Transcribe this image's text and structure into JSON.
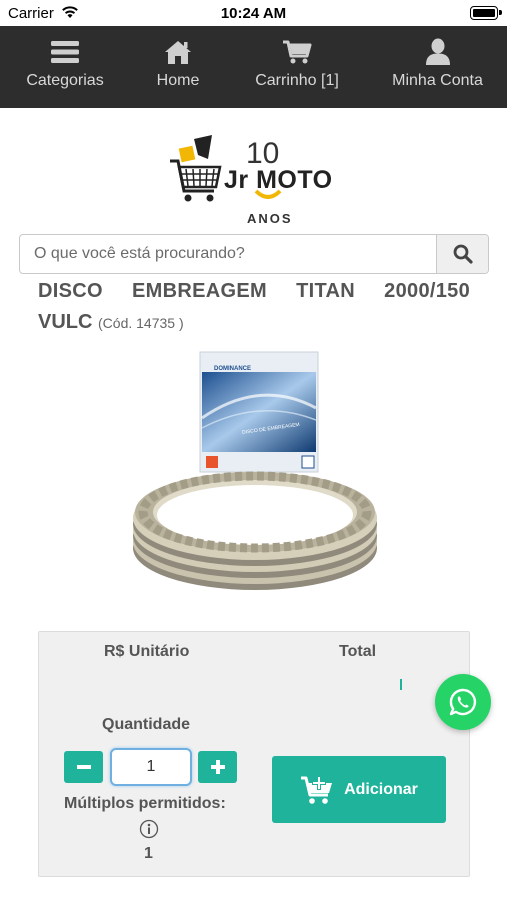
{
  "status_bar": {
    "carrier": "Carrier",
    "time": "10:24 AM"
  },
  "nav": {
    "items": [
      {
        "label": "Categorias",
        "icon": "menu-icon"
      },
      {
        "label": "Home",
        "icon": "home-icon"
      },
      {
        "label": "Carrinho [1]",
        "icon": "cart-icon"
      },
      {
        "label": "Minha Conta",
        "icon": "user-icon"
      }
    ]
  },
  "logo": {
    "number": "10",
    "brand": "Jr MOTO",
    "subtitle": "ANOS"
  },
  "search": {
    "placeholder": "O que você está procurando?",
    "value": ""
  },
  "product": {
    "title_line1": "DISCO EMBREAGEM TITAN 2000/150",
    "title_line2": "VULC",
    "code": "(Cód. 14735 )",
    "box_brand": "DOMINANCE",
    "box_text": "DISCO DE EMBREAGEM"
  },
  "pricing": {
    "unit_label": "R$ Unitário",
    "total_label": "Total",
    "quantity_label": "Quantidade",
    "quantity_value": "1",
    "multiples_label": "Múltiplos permitidos:",
    "multiples_value": "1",
    "add_label": "Adicionar"
  },
  "colors": {
    "nav_bg": "#2d2d2d",
    "accent": "#1fb39b",
    "whatsapp": "#25d366"
  }
}
